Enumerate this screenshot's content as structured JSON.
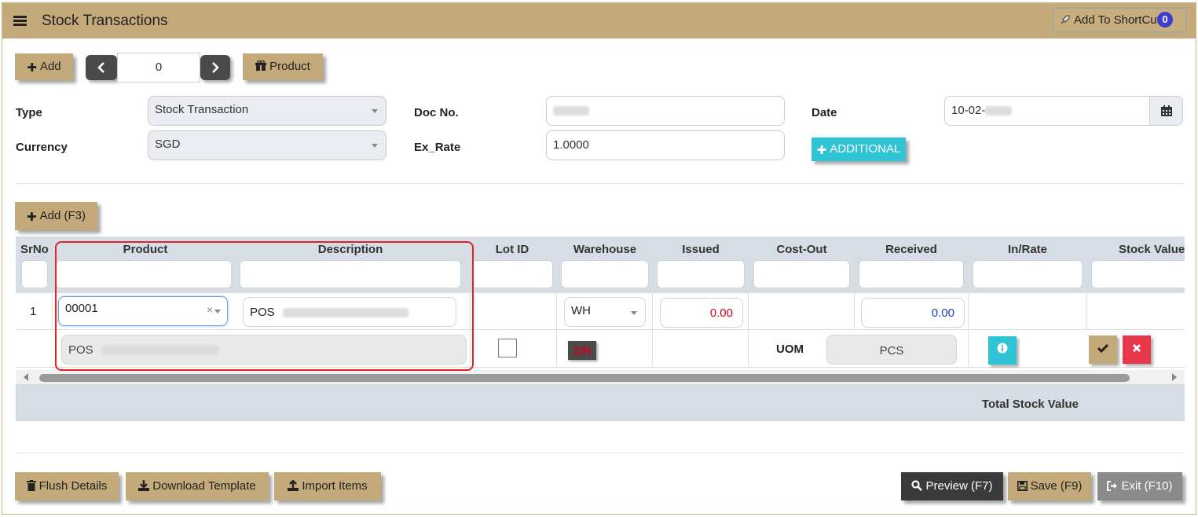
{
  "header": {
    "title": "Stock Transactions",
    "shortcut_label": "Add To ShortCut",
    "shortcut_count": "0"
  },
  "toolbar": {
    "add_label": "Add",
    "record_index": "0",
    "product_label": "Product"
  },
  "form": {
    "type_label": "Type",
    "type_value": "Stock Transaction",
    "doc_no_label": "Doc No.",
    "date_label": "Date",
    "date_value": "10-02-",
    "currency_label": "Currency",
    "currency_value": "SGD",
    "ex_rate_label": "Ex_Rate",
    "ex_rate_value": "1.0000",
    "additional_label": "ADDITIONAL"
  },
  "grid": {
    "add_label": "Add (F3)",
    "columns": [
      "SrNo",
      "Product",
      "Description",
      "Lot ID",
      "Warehouse",
      "Issued",
      "Cost-Out",
      "Received",
      "In/Rate",
      "Stock Value"
    ],
    "row": {
      "srno": "1",
      "product_code": "00001",
      "description": "POS",
      "warehouse": "WH",
      "issued": "0.00",
      "received": "0.00"
    },
    "detail": {
      "product_name": "POS",
      "zr_label": "Z/R",
      "uom_label": "UOM",
      "uom_value": "PCS"
    },
    "total_label": "Total Stock Value"
  },
  "footer": {
    "flush_label": "Flush Details",
    "download_label": "Download Template",
    "import_label": "Import Items",
    "preview_label": "Preview (F7)",
    "save_label": "Save (F9)",
    "exit_label": "Exit (F10)"
  },
  "colors": {
    "accent": "#c4a97a",
    "info": "#2fc3d6",
    "danger": "#e8374a",
    "issued_text": "#d0021b",
    "received_text": "#1a3fc4"
  }
}
